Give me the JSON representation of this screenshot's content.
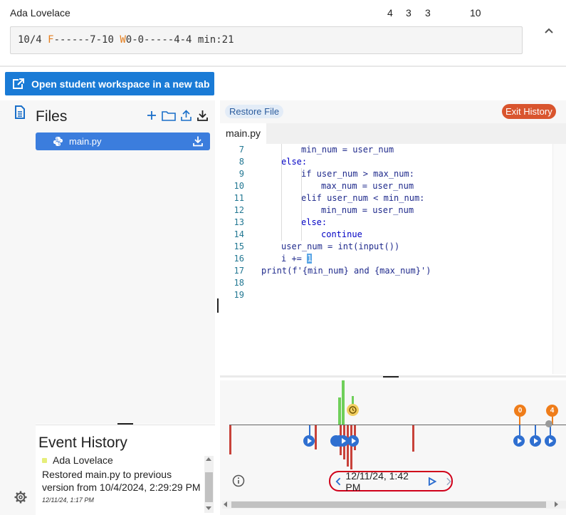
{
  "header": {
    "student_name": "Ada Lovelace",
    "counts": [
      "4",
      "3",
      "3",
      "10"
    ],
    "progress": {
      "date": "10/4",
      "f_marker": "F",
      "f_sequence": "------7-10",
      "w_marker": "W",
      "w_sequence": "0-0-----4-4",
      "min_label": "min:21"
    }
  },
  "toolbar": {
    "open_workspace_label": "Open student workspace in a new tab"
  },
  "files": {
    "title": "Files",
    "items": [
      {
        "name": "main.py"
      }
    ]
  },
  "editor": {
    "restore_label": "Restore File",
    "exit_history_label": "Exit History",
    "active_tab": "main.py",
    "lines": [
      {
        "n": "7",
        "text": "min_num = user_num"
      },
      {
        "n": "8",
        "text": "else:"
      },
      {
        "n": "9",
        "text": "if user_num > max_num:"
      },
      {
        "n": "10",
        "text": "max_num = user_num"
      },
      {
        "n": "11",
        "text": "elif user_num < min_num:"
      },
      {
        "n": "12",
        "text": "min_num = user_num"
      },
      {
        "n": "13",
        "text": "else:"
      },
      {
        "n": "14",
        "text": "continue"
      },
      {
        "n": "15",
        "text": "user_num = int(input())"
      },
      {
        "n": "16",
        "text": "i += 1"
      },
      {
        "n": "17",
        "text": "print(f'{min_num} and {max_num}')"
      },
      {
        "n": "18",
        "text": ""
      },
      {
        "n": "19",
        "text": ""
      }
    ]
  },
  "event_history": {
    "title": "Event History",
    "entries": [
      {
        "user": "Ada Lovelace",
        "message": "Restored main.py to previous version from 10/4/2024, 2:29:29 PM",
        "time": "12/11/24, 1:17 PM"
      }
    ]
  },
  "timeline": {
    "current_time": "12/11/24, 1:42 PM",
    "badges": [
      "0",
      "4"
    ]
  },
  "colors": {
    "primary": "#1a7bd6",
    "file_selected": "#3b7ddd",
    "exit": "#d9552e",
    "badge": "#ef7d1a",
    "error_bar": "#c8423a",
    "run_bar": "#6fcf5a",
    "highlight_frame": "#d0001a"
  },
  "icons": {
    "rail": "file-text-icon",
    "settings": "gear-icon",
    "files_tools": [
      "plus-icon",
      "folder-icon",
      "upload-icon",
      "download-icon"
    ],
    "file_type": "python-icon",
    "collapse": "chevron-up-icon",
    "info": "info-icon",
    "restore_marker": "history-icon"
  }
}
